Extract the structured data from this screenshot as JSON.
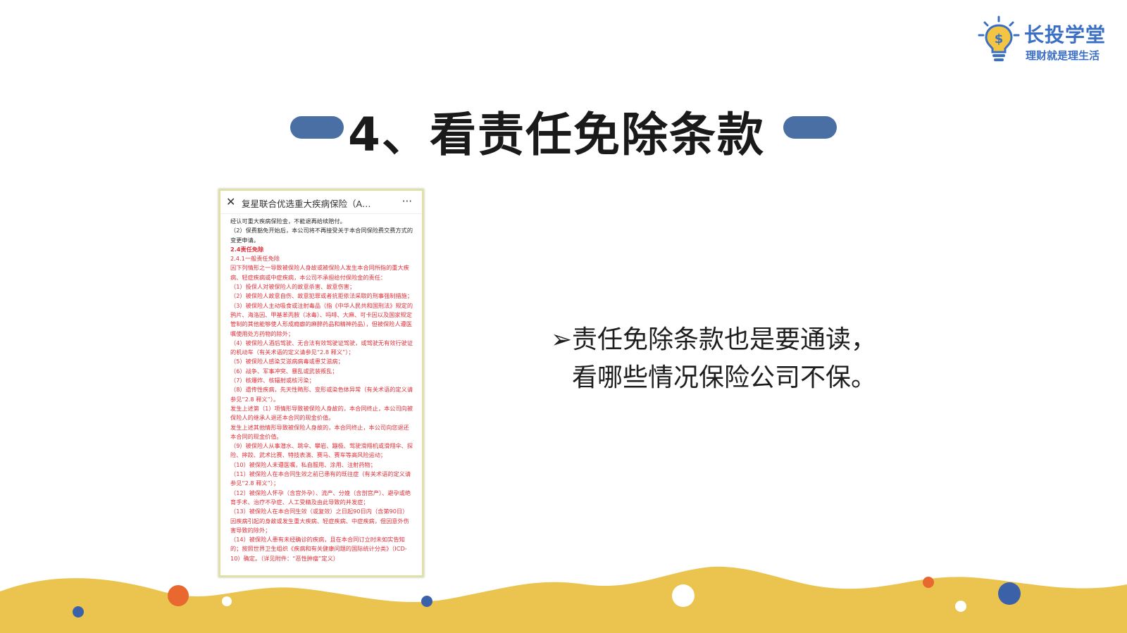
{
  "brand": {
    "name": "长投学堂",
    "slogan": "理财就是理生活",
    "logo_icon": "lightbulb-dollar-icon",
    "color": "#3b6fc4"
  },
  "slide": {
    "title": "4、看责任免除条款",
    "bar_color": "#4a6fa5"
  },
  "phone": {
    "close_icon": "close-icon",
    "title": "复星联合优选重大疾病保险（A…",
    "more_icon": "more-icon",
    "lines": [
      {
        "text": "经认可重大疾病保险金，不能退再给续赔付。",
        "style": "dark"
      },
      {
        "text": "（2）保费豁免开始后，本公司将不再接受关于本合同保险费交费方式的变更申请。",
        "style": "dark"
      },
      {
        "text": "2.4责任免除",
        "style": "red-bold"
      },
      {
        "text": "2.4.1一般责任免除",
        "style": "red"
      },
      {
        "text": "因下列情形之一导致被保险人身故或被保险人发生本合同所指的重大疾病、轻症疾病或中症疾病，本公司不承担给付保险金的责任：",
        "style": "red"
      },
      {
        "text": "（1）投保人对被保险人的故意杀害、故意伤害；",
        "style": "red"
      },
      {
        "text": "（2）被保险人故意自伤、故意犯罪或者抗拒依法采取的刑事强制措施；",
        "style": "red"
      },
      {
        "text": "（3）被保险人主动吸食或注射毒品（指《中华人民共和国刑法》规定的鸦片、海洛因、甲基苯丙胺（冰毒）、吗啡、大麻、可卡因以及国家规定管制的其他能够使人形成瘾癖的麻醉药品和精神药品），但被保险人遵医嘱使用处方药物的除外；",
        "style": "red"
      },
      {
        "text": "（4）被保险人酒后驾驶、无合法有效驾驶证驾驶，或驾驶无有效行驶证的机动车（有关术语的定义请参见“2.8 释义”）；",
        "style": "red"
      },
      {
        "text": "（5）被保险人感染艾滋病病毒或患艾滋病；",
        "style": "red"
      },
      {
        "text": "（6）战争、军事冲突、暴乱或武装叛乱；",
        "style": "red"
      },
      {
        "text": "（7）核爆炸、核辐射或核污染；",
        "style": "red"
      },
      {
        "text": "（8）遗传性疾病，先天性畸形、变形或染色体异常（有关术语的定义请参见“2.8 释义”）。",
        "style": "red"
      },
      {
        "text": "发生上述第（1）项情形导致被保险人身故的，本合同终止，本公司向被保险人的继承人退还本合同的现金价值。",
        "style": "red"
      },
      {
        "text": "发生上述其他情形导致被保险人身故的，本合同终止，本公司向您退还本合同的现金价值。",
        "style": "red"
      },
      {
        "text": "（9）被保险人从事潜水、跳伞、攀岩、蹦极、驾驶滑翔机或滑翔伞、探险、摔跤、武术比赛、特技表演、赛马、赛车等高风险运动；",
        "style": "red"
      },
      {
        "text": "（10）被保险人未遵医嘱，私自服用、涂用、注射药物；",
        "style": "red"
      },
      {
        "text": "（11）被保险人在本合同生效之前已患有的既往症（有关术语的定义请参见“2.8 释义”）；",
        "style": "red"
      },
      {
        "text": "（12）被保险人怀孕（含宫外孕）、流产、分娩（含剖宫产）、避孕或绝育手术、治疗不孕症、人工受精及由此导致的并发症；",
        "style": "red"
      },
      {
        "text": "（13）被保险人在本合同生效（或复效）之日起90日内（含第90日）因疾病引起的身故或发生重大疾病、轻症疾病、中症疾病，但因意外伤害导致的除外；",
        "style": "red"
      },
      {
        "text": "（14）被保险人患有未经确诊的疾病，且在本合同订立时未如实告知的；按照世界卫生组织《疾病和有关健康问题的国际统计分类》（ICD-10）确定。（详见附件：“恶性肿瘤”定义）",
        "style": "red"
      }
    ]
  },
  "bullet": {
    "icon": "arrow-bullet-icon",
    "glyph": "➢",
    "line1": "责任免除条款也是要通读，",
    "line2": "看哪些情况保险公司不保。"
  },
  "decor": {
    "wave_color": "#ebc44f",
    "dot_orange": "#e8682f",
    "dot_blue": "#3b62a8",
    "dot_white": "#ffffff"
  }
}
